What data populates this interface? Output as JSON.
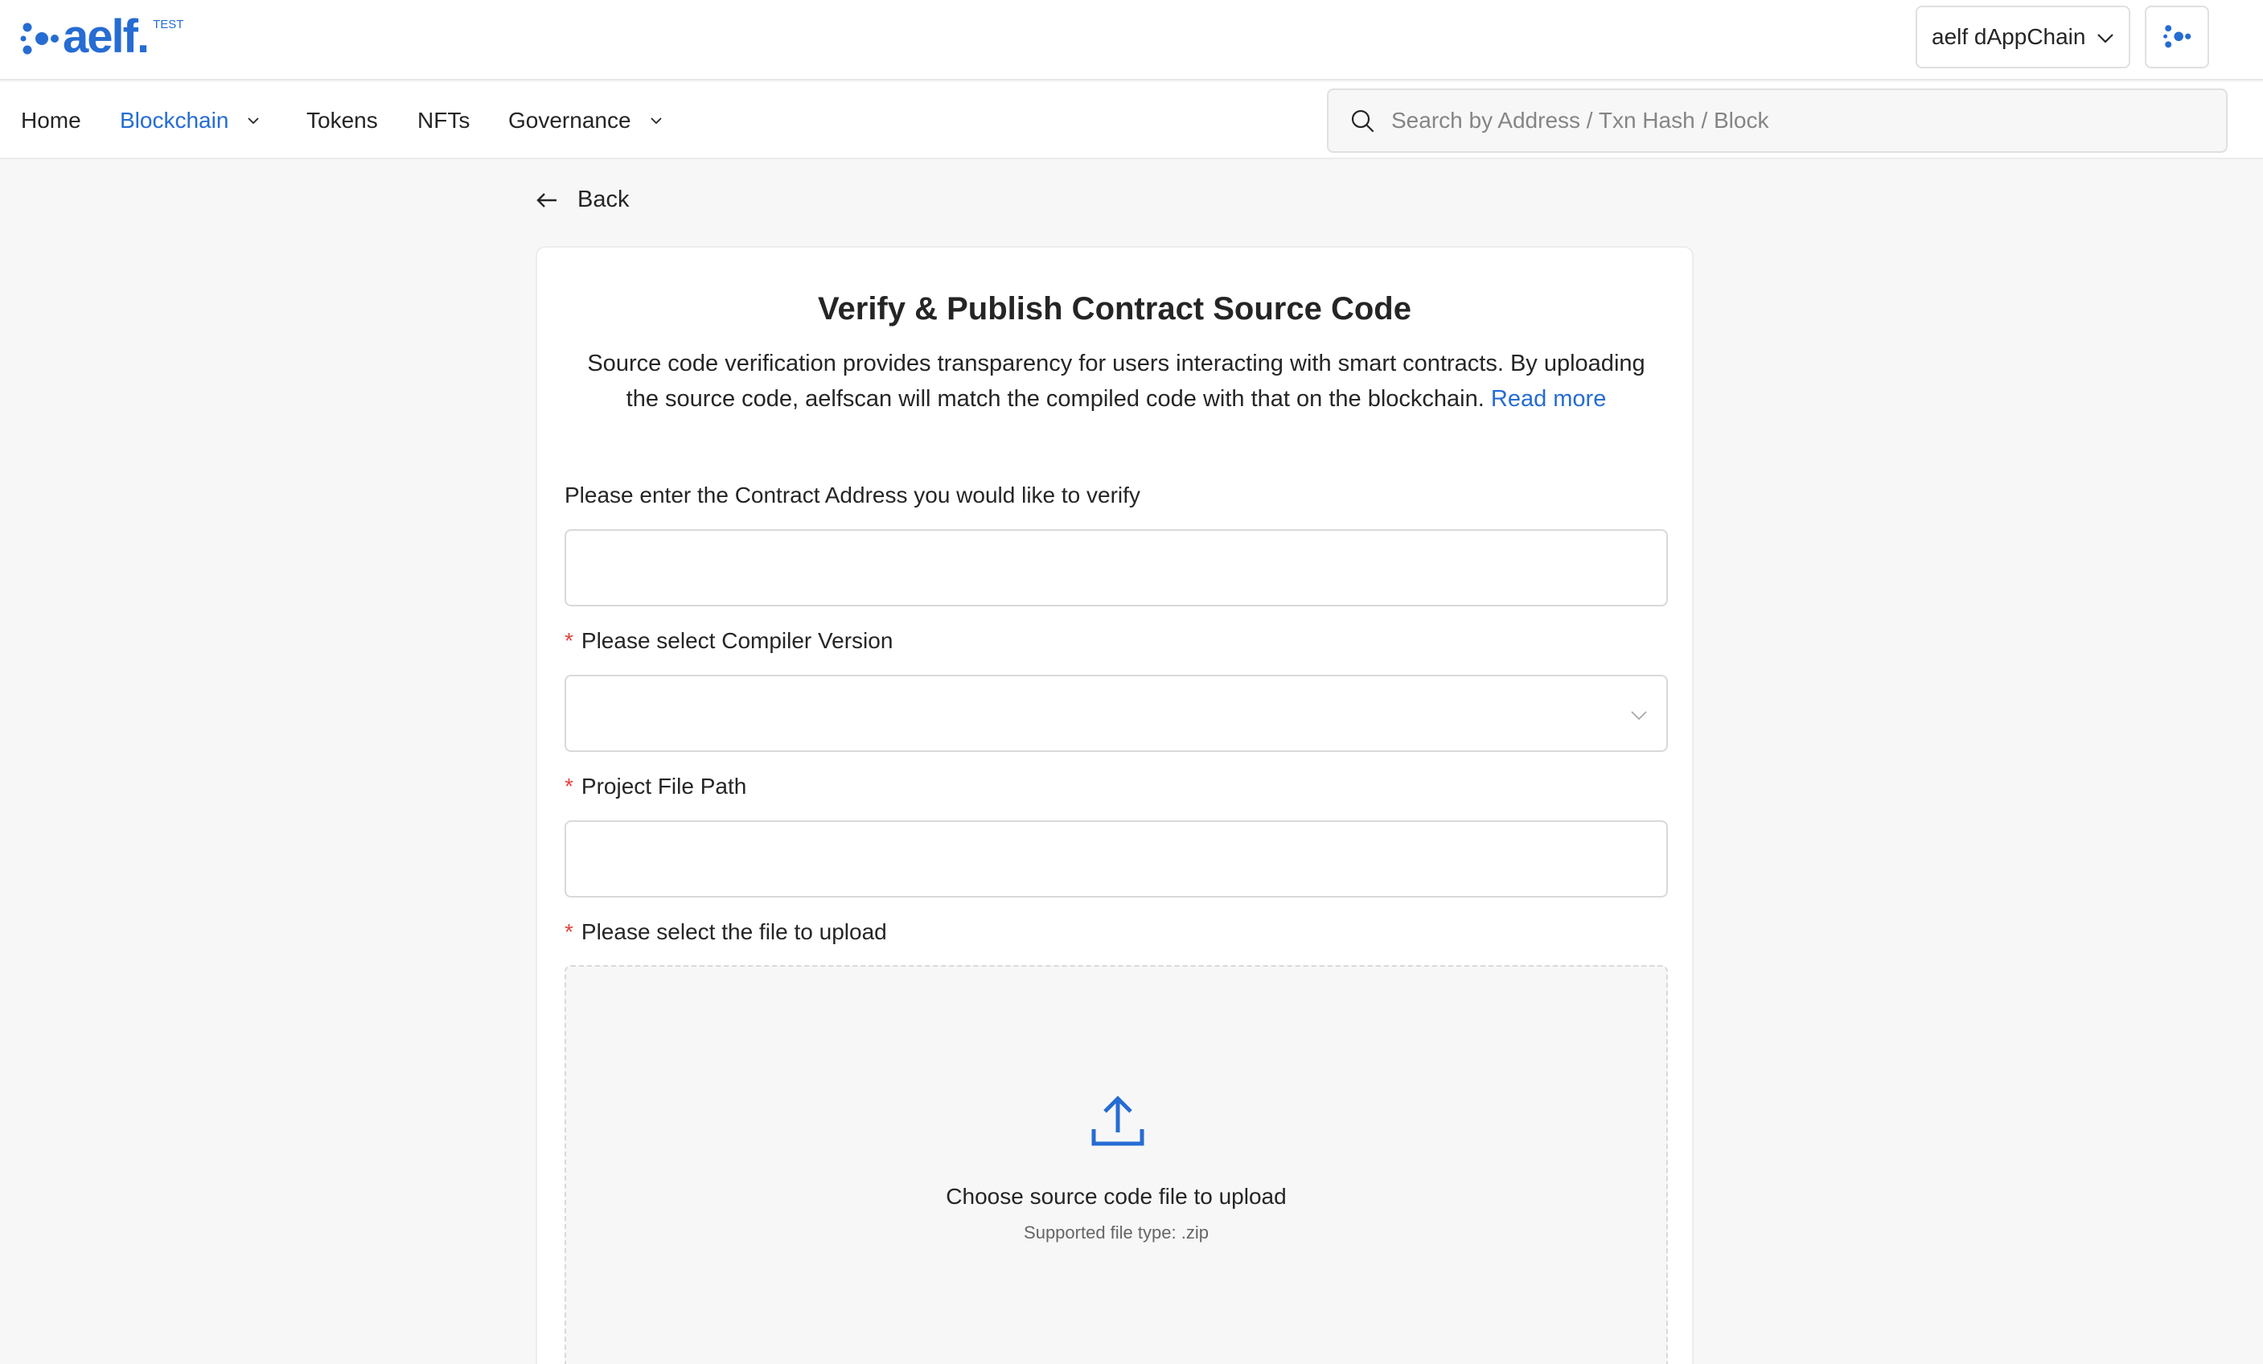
{
  "brand": {
    "logo_text": "aelf.",
    "tag": "TEST",
    "accent": "#266cd3"
  },
  "header": {
    "chain_selector": "aelf dAppChain"
  },
  "nav": {
    "items": [
      {
        "label": "Home",
        "active": false,
        "dropdown": false
      },
      {
        "label": "Blockchain",
        "active": true,
        "dropdown": true
      },
      {
        "label": "Tokens",
        "active": false,
        "dropdown": false
      },
      {
        "label": "NFTs",
        "active": false,
        "dropdown": false
      },
      {
        "label": "Governance",
        "active": false,
        "dropdown": true
      }
    ],
    "search_placeholder": "Search by Address / Txn Hash / Block"
  },
  "page": {
    "back_label": "Back",
    "title": "Verify & Publish Contract Source Code",
    "description": "Source code verification provides transparency for users interacting with smart contracts. By uploading the source code, aelfscan will match the compiled code with that on the blockchain.",
    "read_more": "Read more"
  },
  "form": {
    "contract_address_label": "Please enter the Contract Address you would like to verify",
    "contract_address_value": "",
    "compiler_version_label": "Please select Compiler Version",
    "compiler_version_value": "",
    "project_path_label": "Project File Path",
    "project_path_value": "",
    "file_label": "Please select the file to upload",
    "required_mark": "*",
    "upload_title": "Choose source code file to upload",
    "upload_sub": "Supported file type: .zip"
  }
}
